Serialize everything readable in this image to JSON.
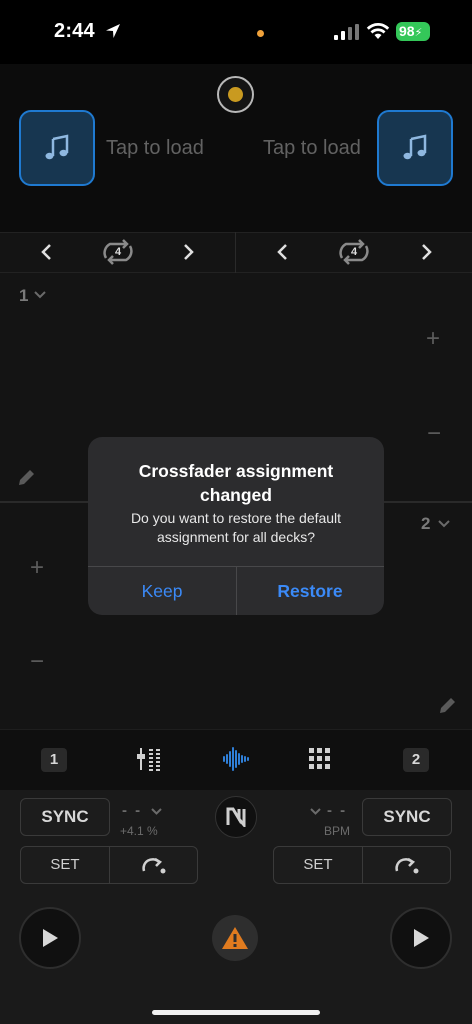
{
  "status_bar": {
    "time": "2:44",
    "battery": "98"
  },
  "decks": {
    "load_text_left": "Tap to load",
    "load_text_right": "Tap to load",
    "loop_left": "4",
    "loop_right": "4",
    "deck1_label": "1",
    "deck2_label": "2",
    "plus": "+",
    "minus": "−"
  },
  "dialog": {
    "title": "Crossfader assignment changed",
    "message": "Do you want to restore the default assignment for all decks?",
    "keep_label": "Keep",
    "restore_label": "Restore"
  },
  "mode_row": {
    "deck1": "1",
    "deck2": "2"
  },
  "controls": {
    "sync_left": "SYNC",
    "sync_right": "SYNC",
    "pitch_dashes_left": "- -",
    "pitch_left": "+4.1 %",
    "bpm_dashes_right": "- -",
    "bpm_label": "BPM",
    "set_left": "SET",
    "set_right": "SET"
  },
  "colors": {
    "accent": "#3b8af7",
    "load_tile_border": "#1f7ad1",
    "warning": "#e07b1f",
    "battery": "#34c759"
  }
}
